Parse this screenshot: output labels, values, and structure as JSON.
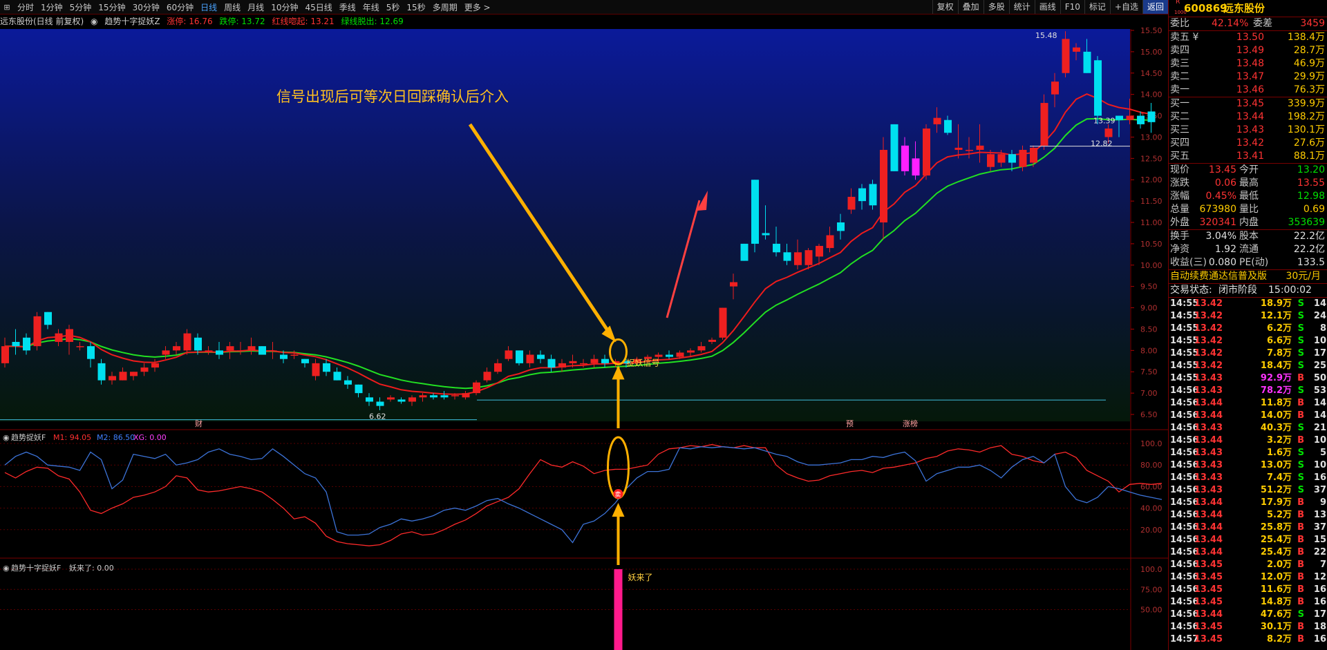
{
  "toolbar": {
    "periods": [
      "分时",
      "1分钟",
      "5分钟",
      "15分钟",
      "30分钟",
      "60分钟",
      "日线",
      "周线",
      "月线",
      "10分钟",
      "45日线",
      "季线",
      "年线",
      "5秒",
      "15秒",
      "多周期",
      "更多 >"
    ],
    "active_period": "日线",
    "tools": [
      "复权",
      "叠加",
      "多股",
      "统计",
      "画线",
      "F10",
      "标记",
      "+自选",
      "返回"
    ]
  },
  "info": {
    "stock": "远东股份(日线 前复权)",
    "indicator": "趋势十字捉妖Z",
    "zhangting": "涨停: 16.76",
    "dieting": "跌停: 13.72",
    "red_label": "红线唿起: 13.21",
    "green_label": "绿线脱出: 12.69"
  },
  "main_panel": {
    "annotation": "信号出现后可等次日回踩确认后介入",
    "signal_label": "捉妖信号",
    "high_label": "15.48",
    "low_label": "6.62",
    "level_label_1": "13.39",
    "level_label_2": "12.82",
    "marks": [
      "财",
      "预",
      "涨榜"
    ],
    "y_ticks": [
      "15.50",
      "15.00",
      "14.50",
      "14.00",
      "13.50",
      "13.00",
      "12.50",
      "12.00",
      "11.50",
      "11.00",
      "10.50",
      "10.00",
      "9.50",
      "9.00",
      "8.50",
      "8.00",
      "7.50",
      "7.00",
      "6.50"
    ]
  },
  "osc_panel": {
    "title": "趋势捉妖F",
    "m1": "M1: 94.05",
    "m2": "M2: 86.50",
    "xg": "XG: 0.00",
    "badge": "卖",
    "y_ticks": [
      "100.0",
      "80.00",
      "60.00",
      "40.00",
      "20.00"
    ]
  },
  "bar_panel": {
    "title": "趋势十字捉妖F",
    "value": "妖来了: 0.00",
    "bar_label": "妖来了",
    "y_ticks": [
      "100.0",
      "75.00",
      "50.00"
    ]
  },
  "quote": {
    "code": "600869",
    "name": "远东股份",
    "superscript": "R",
    "sub_small": "1000",
    "weibi_label": "委比",
    "weibi": "42.14%",
    "weicha_label": "委差",
    "weicha": "3459",
    "asks": [
      {
        "label": "卖五 ¥",
        "price": "13.50",
        "vol": "138.4万"
      },
      {
        "label": "卖四",
        "price": "13.49",
        "vol": "28.7万"
      },
      {
        "label": "卖三",
        "price": "13.48",
        "vol": "46.9万"
      },
      {
        "label": "卖二",
        "price": "13.47",
        "vol": "29.9万"
      },
      {
        "label": "卖一",
        "price": "13.46",
        "vol": "76.3万"
      }
    ],
    "bids": [
      {
        "label": "买一",
        "price": "13.45",
        "vol": "339.9万"
      },
      {
        "label": "买二",
        "price": "13.44",
        "vol": "198.2万"
      },
      {
        "label": "买三",
        "price": "13.43",
        "vol": "130.1万"
      },
      {
        "label": "买四",
        "price": "13.42",
        "vol": "27.6万"
      },
      {
        "label": "买五",
        "price": "13.41",
        "vol": "88.1万"
      }
    ],
    "stats": [
      {
        "l1": "现价",
        "v1": "13.45",
        "c1": "red",
        "l2": "今开",
        "v2": "13.20",
        "c2": "green"
      },
      {
        "l1": "涨跌",
        "v1": "0.06",
        "c1": "red",
        "l2": "最高",
        "v2": "13.55",
        "c2": "red"
      },
      {
        "l1": "涨幅",
        "v1": "0.45%",
        "c1": "red",
        "l2": "最低",
        "v2": "12.98",
        "c2": "green"
      },
      {
        "l1": "总量",
        "v1": "673980",
        "c1": "yellow",
        "l2": "量比",
        "v2": "0.69",
        "c2": "yellow"
      },
      {
        "l1": "外盘",
        "v1": "320341",
        "c1": "red",
        "l2": "内盘",
        "v2": "353639",
        "c2": "green"
      }
    ],
    "stats2": [
      {
        "l1": "换手",
        "v1": "3.04%",
        "l2": "股本",
        "v2": "22.2亿"
      },
      {
        "l1": "净资",
        "v1": "1.92",
        "l2": "流通",
        "v2": "22.2亿"
      },
      {
        "l1": "收益(三)",
        "v1": "0.080",
        "l2": "PE(动)",
        "v2": "133.5"
      }
    ],
    "ad": "自动续费通达信普及版",
    "ad_price": "30元/月",
    "status_label": "交易状态:",
    "status": "闭市阶段",
    "status_time": "15:00:02",
    "ticks": [
      [
        "14:55",
        "13.42",
        "18.9万",
        "S",
        "14"
      ],
      [
        "14:55",
        "13.42",
        "12.1万",
        "S",
        "24"
      ],
      [
        "14:55",
        "13.42",
        "6.2万",
        "S",
        "8"
      ],
      [
        "14:55",
        "13.42",
        "6.6万",
        "S",
        "10"
      ],
      [
        "14:55",
        "13.42",
        "7.8万",
        "S",
        "17"
      ],
      [
        "14:55",
        "13.42",
        "18.4万",
        "S",
        "25"
      ],
      [
        "14:55",
        "13.43",
        "92.9万",
        "B",
        "50"
      ],
      [
        "14:56",
        "13.43",
        "78.2万",
        "S",
        "53"
      ],
      [
        "14:56",
        "13.44",
        "11.8万",
        "B",
        "14"
      ],
      [
        "14:56",
        "13.44",
        "14.0万",
        "B",
        "14"
      ],
      [
        "14:56",
        "13.43",
        "40.3万",
        "S",
        "21"
      ],
      [
        "14:56",
        "13.44",
        "3.2万",
        "B",
        "10"
      ],
      [
        "14:56",
        "13.43",
        "1.6万",
        "S",
        "5"
      ],
      [
        "14:56",
        "13.43",
        "13.0万",
        "S",
        "10"
      ],
      [
        "14:56",
        "13.43",
        "7.4万",
        "S",
        "16"
      ],
      [
        "14:56",
        "13.43",
        "51.2万",
        "S",
        "37"
      ],
      [
        "14:56",
        "13.44",
        "17.9万",
        "B",
        "9"
      ],
      [
        "14:56",
        "13.44",
        "5.2万",
        "B",
        "13"
      ],
      [
        "14:56",
        "13.44",
        "25.8万",
        "B",
        "37"
      ],
      [
        "14:56",
        "13.44",
        "25.4万",
        "B",
        "15"
      ],
      [
        "14:56",
        "13.44",
        "25.4万",
        "B",
        "22"
      ],
      [
        "14:56",
        "13.45",
        "2.0万",
        "B",
        "7"
      ],
      [
        "14:56",
        "13.45",
        "12.0万",
        "B",
        "12"
      ],
      [
        "14:56",
        "13.45",
        "11.6万",
        "B",
        "16"
      ],
      [
        "14:56",
        "13.45",
        "14.8万",
        "B",
        "16"
      ],
      [
        "14:56",
        "13.44",
        "47.6万",
        "S",
        "17"
      ],
      [
        "14:56",
        "13.45",
        "30.1万",
        "B",
        "18"
      ],
      [
        "14:57",
        "13.45",
        "8.2万",
        "B",
        "16"
      ]
    ]
  },
  "chart_data": [
    {
      "type": "candlestick",
      "price_range": [
        6.5,
        15.5
      ],
      "ohlc": [
        [
          7.7,
          8.3,
          7.6,
          8.1
        ],
        [
          8.2,
          8.5,
          7.9,
          8.1
        ],
        [
          8.3,
          8.4,
          7.9,
          8.0
        ],
        [
          8.1,
          8.9,
          8.0,
          8.8
        ],
        [
          8.9,
          8.9,
          8.5,
          8.6
        ],
        [
          8.2,
          8.5,
          8.1,
          8.4
        ],
        [
          8.2,
          8.6,
          7.9,
          8.5
        ],
        [
          8.1,
          8.2,
          8.0,
          8.1
        ],
        [
          8.1,
          8.2,
          7.6,
          7.8
        ],
        [
          7.7,
          7.8,
          7.2,
          7.3
        ],
        [
          7.3,
          7.5,
          7.2,
          7.4
        ],
        [
          7.3,
          7.6,
          7.3,
          7.5
        ],
        [
          7.4,
          7.5,
          7.3,
          7.5
        ],
        [
          7.5,
          7.7,
          7.4,
          7.6
        ],
        [
          7.6,
          7.8,
          7.5,
          7.7
        ],
        [
          7.9,
          8.1,
          7.8,
          8.0
        ],
        [
          8.0,
          8.2,
          7.9,
          8.1
        ],
        [
          8.0,
          8.5,
          7.9,
          8.4
        ],
        [
          8.3,
          8.4,
          7.9,
          8.0
        ],
        [
          8.0,
          8.1,
          7.9,
          8.0
        ],
        [
          8.0,
          8.2,
          7.8,
          7.9
        ],
        [
          8.0,
          8.2,
          7.8,
          8.1
        ],
        [
          8.0,
          8.2,
          7.9,
          8.0
        ],
        [
          8.0,
          8.3,
          7.9,
          8.1
        ],
        [
          8.1,
          8.1,
          7.9,
          7.9
        ],
        [
          8.0,
          8.2,
          7.8,
          8.0
        ],
        [
          7.9,
          8.0,
          7.7,
          7.8
        ],
        [
          7.9,
          8.0,
          7.8,
          7.9
        ],
        [
          7.8,
          7.8,
          7.6,
          7.7
        ],
        [
          7.4,
          7.8,
          7.3,
          7.7
        ],
        [
          7.7,
          7.8,
          7.4,
          7.5
        ],
        [
          7.5,
          7.6,
          7.3,
          7.3
        ],
        [
          7.3,
          7.4,
          7.1,
          7.2
        ],
        [
          7.2,
          7.2,
          6.9,
          7.0
        ],
        [
          6.9,
          7.0,
          6.7,
          6.8
        ],
        [
          6.8,
          6.9,
          6.6,
          6.7
        ],
        [
          6.85,
          6.95,
          6.8,
          6.9
        ],
        [
          6.85,
          6.9,
          6.75,
          6.8
        ],
        [
          6.8,
          6.95,
          6.7,
          6.9
        ],
        [
          6.9,
          7.0,
          6.8,
          6.95
        ],
        [
          6.95,
          7.0,
          6.85,
          6.9
        ],
        [
          6.95,
          7.05,
          6.85,
          6.9
        ],
        [
          6.95,
          7.0,
          6.85,
          6.95
        ],
        [
          6.9,
          7.05,
          6.85,
          7.0
        ],
        [
          7.0,
          7.3,
          6.95,
          7.25
        ],
        [
          7.3,
          7.6,
          7.25,
          7.5
        ],
        [
          7.5,
          7.8,
          7.45,
          7.7
        ],
        [
          7.8,
          8.1,
          7.75,
          8.0
        ],
        [
          8.0,
          8.0,
          7.65,
          7.7
        ],
        [
          7.7,
          8.0,
          7.6,
          7.9
        ],
        [
          7.9,
          8.0,
          7.7,
          7.8
        ],
        [
          7.8,
          7.9,
          7.5,
          7.6
        ],
        [
          7.6,
          7.8,
          7.5,
          7.7
        ],
        [
          7.7,
          7.9,
          7.6,
          7.75
        ],
        [
          7.7,
          7.8,
          7.6,
          7.7
        ],
        [
          7.7,
          7.9,
          7.6,
          7.8
        ],
        [
          7.8,
          7.9,
          7.6,
          7.7
        ],
        [
          7.7,
          7.8,
          7.6,
          7.75
        ],
        [
          7.75,
          7.8,
          7.6,
          7.7
        ],
        [
          7.7,
          7.85,
          7.65,
          7.8
        ],
        [
          7.8,
          7.9,
          7.7,
          7.85
        ],
        [
          7.85,
          7.95,
          7.7,
          7.9
        ],
        [
          7.9,
          8.0,
          7.8,
          7.85
        ],
        [
          7.85,
          8.0,
          7.8,
          7.95
        ],
        [
          7.95,
          8.05,
          7.85,
          8.0
        ],
        [
          8.0,
          8.2,
          7.95,
          8.1
        ],
        [
          8.2,
          8.3,
          8.15,
          8.25
        ],
        [
          8.3,
          9.0,
          8.25,
          9.0
        ],
        [
          9.5,
          9.8,
          9.2,
          9.6
        ],
        [
          10.5,
          10.5,
          10.1,
          10.1
        ],
        [
          12.0,
          12.0,
          10.3,
          10.5
        ],
        [
          10.75,
          11.4,
          10.6,
          10.7
        ],
        [
          10.5,
          10.9,
          10.2,
          10.3
        ],
        [
          10.3,
          10.5,
          10.0,
          10.1
        ],
        [
          10.0,
          10.6,
          9.9,
          10.3
        ],
        [
          10.0,
          10.4,
          9.9,
          10.35
        ],
        [
          10.2,
          10.5,
          10.0,
          10.45
        ],
        [
          10.4,
          10.9,
          10.3,
          10.7
        ],
        [
          11.0,
          11.2,
          10.6,
          10.8
        ],
        [
          11.3,
          11.8,
          11.2,
          11.6
        ],
        [
          11.8,
          11.9,
          11.3,
          11.5
        ],
        [
          11.9,
          12.0,
          11.3,
          11.4
        ],
        [
          11.0,
          13.0,
          10.6,
          12.7
        ],
        [
          13.3,
          13.3,
          12.2,
          12.2
        ],
        [
          12.2,
          13.0,
          12.1,
          12.8
        ],
        [
          12.1,
          12.9,
          12.0,
          12.5
        ],
        [
          12.1,
          13.3,
          12.0,
          13.2
        ],
        [
          13.3,
          13.7,
          13.1,
          13.45
        ],
        [
          13.4,
          13.5,
          13.05,
          13.1
        ],
        [
          12.7,
          13.3,
          12.5,
          12.75
        ],
        [
          12.7,
          13.0,
          12.5,
          12.7
        ],
        [
          12.7,
          13.3,
          12.4,
          12.8
        ],
        [
          12.3,
          12.7,
          12.2,
          12.6
        ],
        [
          12.4,
          12.7,
          12.3,
          12.6
        ],
        [
          12.6,
          12.7,
          12.2,
          12.4
        ],
        [
          12.3,
          12.8,
          12.2,
          12.7
        ],
        [
          12.4,
          12.8,
          12.3,
          12.75
        ],
        [
          12.8,
          14.0,
          12.7,
          13.8
        ],
        [
          14.0,
          14.5,
          13.7,
          14.3
        ],
        [
          14.5,
          15.48,
          14.4,
          15.3
        ],
        [
          15.0,
          15.2,
          14.8,
          15.1
        ],
        [
          15.0,
          15.3,
          14.5,
          14.5
        ],
        [
          14.8,
          14.9,
          13.3,
          13.5
        ],
        [
          13.0,
          13.3,
          12.85,
          13.2
        ],
        [
          13.5,
          13.5,
          13.0,
          13.4
        ],
        [
          13.4,
          13.9,
          13.3,
          13.5
        ],
        [
          13.5,
          13.6,
          13.2,
          13.3
        ],
        [
          13.6,
          13.8,
          13.1,
          13.35
        ]
      ],
      "signal_index": 57
    },
    {
      "type": "line",
      "series": [
        {
          "name": "M1",
          "color": "#ff2a2a",
          "values": [
            73,
            68,
            74,
            78,
            77,
            70,
            67,
            55,
            38,
            35,
            40,
            44,
            50,
            52,
            55,
            60,
            70,
            68,
            57,
            55,
            56,
            58,
            60,
            58,
            55,
            48,
            40,
            30,
            32,
            26,
            14,
            9,
            7,
            6,
            5,
            6,
            10,
            16,
            18,
            15,
            16,
            20,
            25,
            29,
            35,
            42,
            46,
            50,
            58,
            72,
            85,
            80,
            78,
            83,
            79,
            72,
            75,
            76,
            76,
            78,
            80,
            90,
            95,
            96,
            98,
            97,
            99,
            97,
            96,
            98,
            96,
            96,
            80,
            72,
            68,
            65,
            66,
            70,
            72,
            74,
            75,
            73,
            77,
            78,
            80,
            82,
            86,
            88,
            93,
            95,
            94,
            92,
            96,
            98,
            90,
            88,
            84,
            82,
            90,
            92,
            87,
            75,
            70,
            65,
            55,
            62,
            63,
            62,
            63
          ]
        },
        {
          "name": "M2",
          "color": "#3c73d8",
          "values": [
            80,
            88,
            92,
            88,
            80,
            79,
            78,
            75,
            92,
            85,
            58,
            66,
            90,
            88,
            86,
            90,
            80,
            82,
            85,
            92,
            95,
            90,
            88,
            85,
            86,
            95,
            88,
            80,
            72,
            68,
            55,
            18,
            15,
            15,
            16,
            22,
            25,
            30,
            28,
            30,
            33,
            38,
            40,
            38,
            42,
            47,
            49,
            44,
            40,
            35,
            30,
            25,
            20,
            8,
            25,
            28,
            35,
            45,
            58,
            68,
            74,
            74,
            76,
            96,
            95,
            97,
            96,
            97,
            96,
            95,
            96,
            93,
            90,
            88,
            83,
            80,
            80,
            81,
            82,
            85,
            85,
            88,
            87,
            90,
            92,
            84,
            65,
            72,
            75,
            78,
            78,
            80,
            75,
            68,
            78,
            85,
            88,
            82,
            90,
            60,
            48,
            45,
            50,
            60,
            58,
            55,
            52,
            50,
            48
          ]
        }
      ],
      "y_range": [
        0,
        100
      ]
    },
    {
      "type": "bar",
      "series": [
        {
          "name": "妖来了",
          "values": [
            100
          ]
        }
      ],
      "y_range": [
        0,
        100
      ]
    }
  ]
}
